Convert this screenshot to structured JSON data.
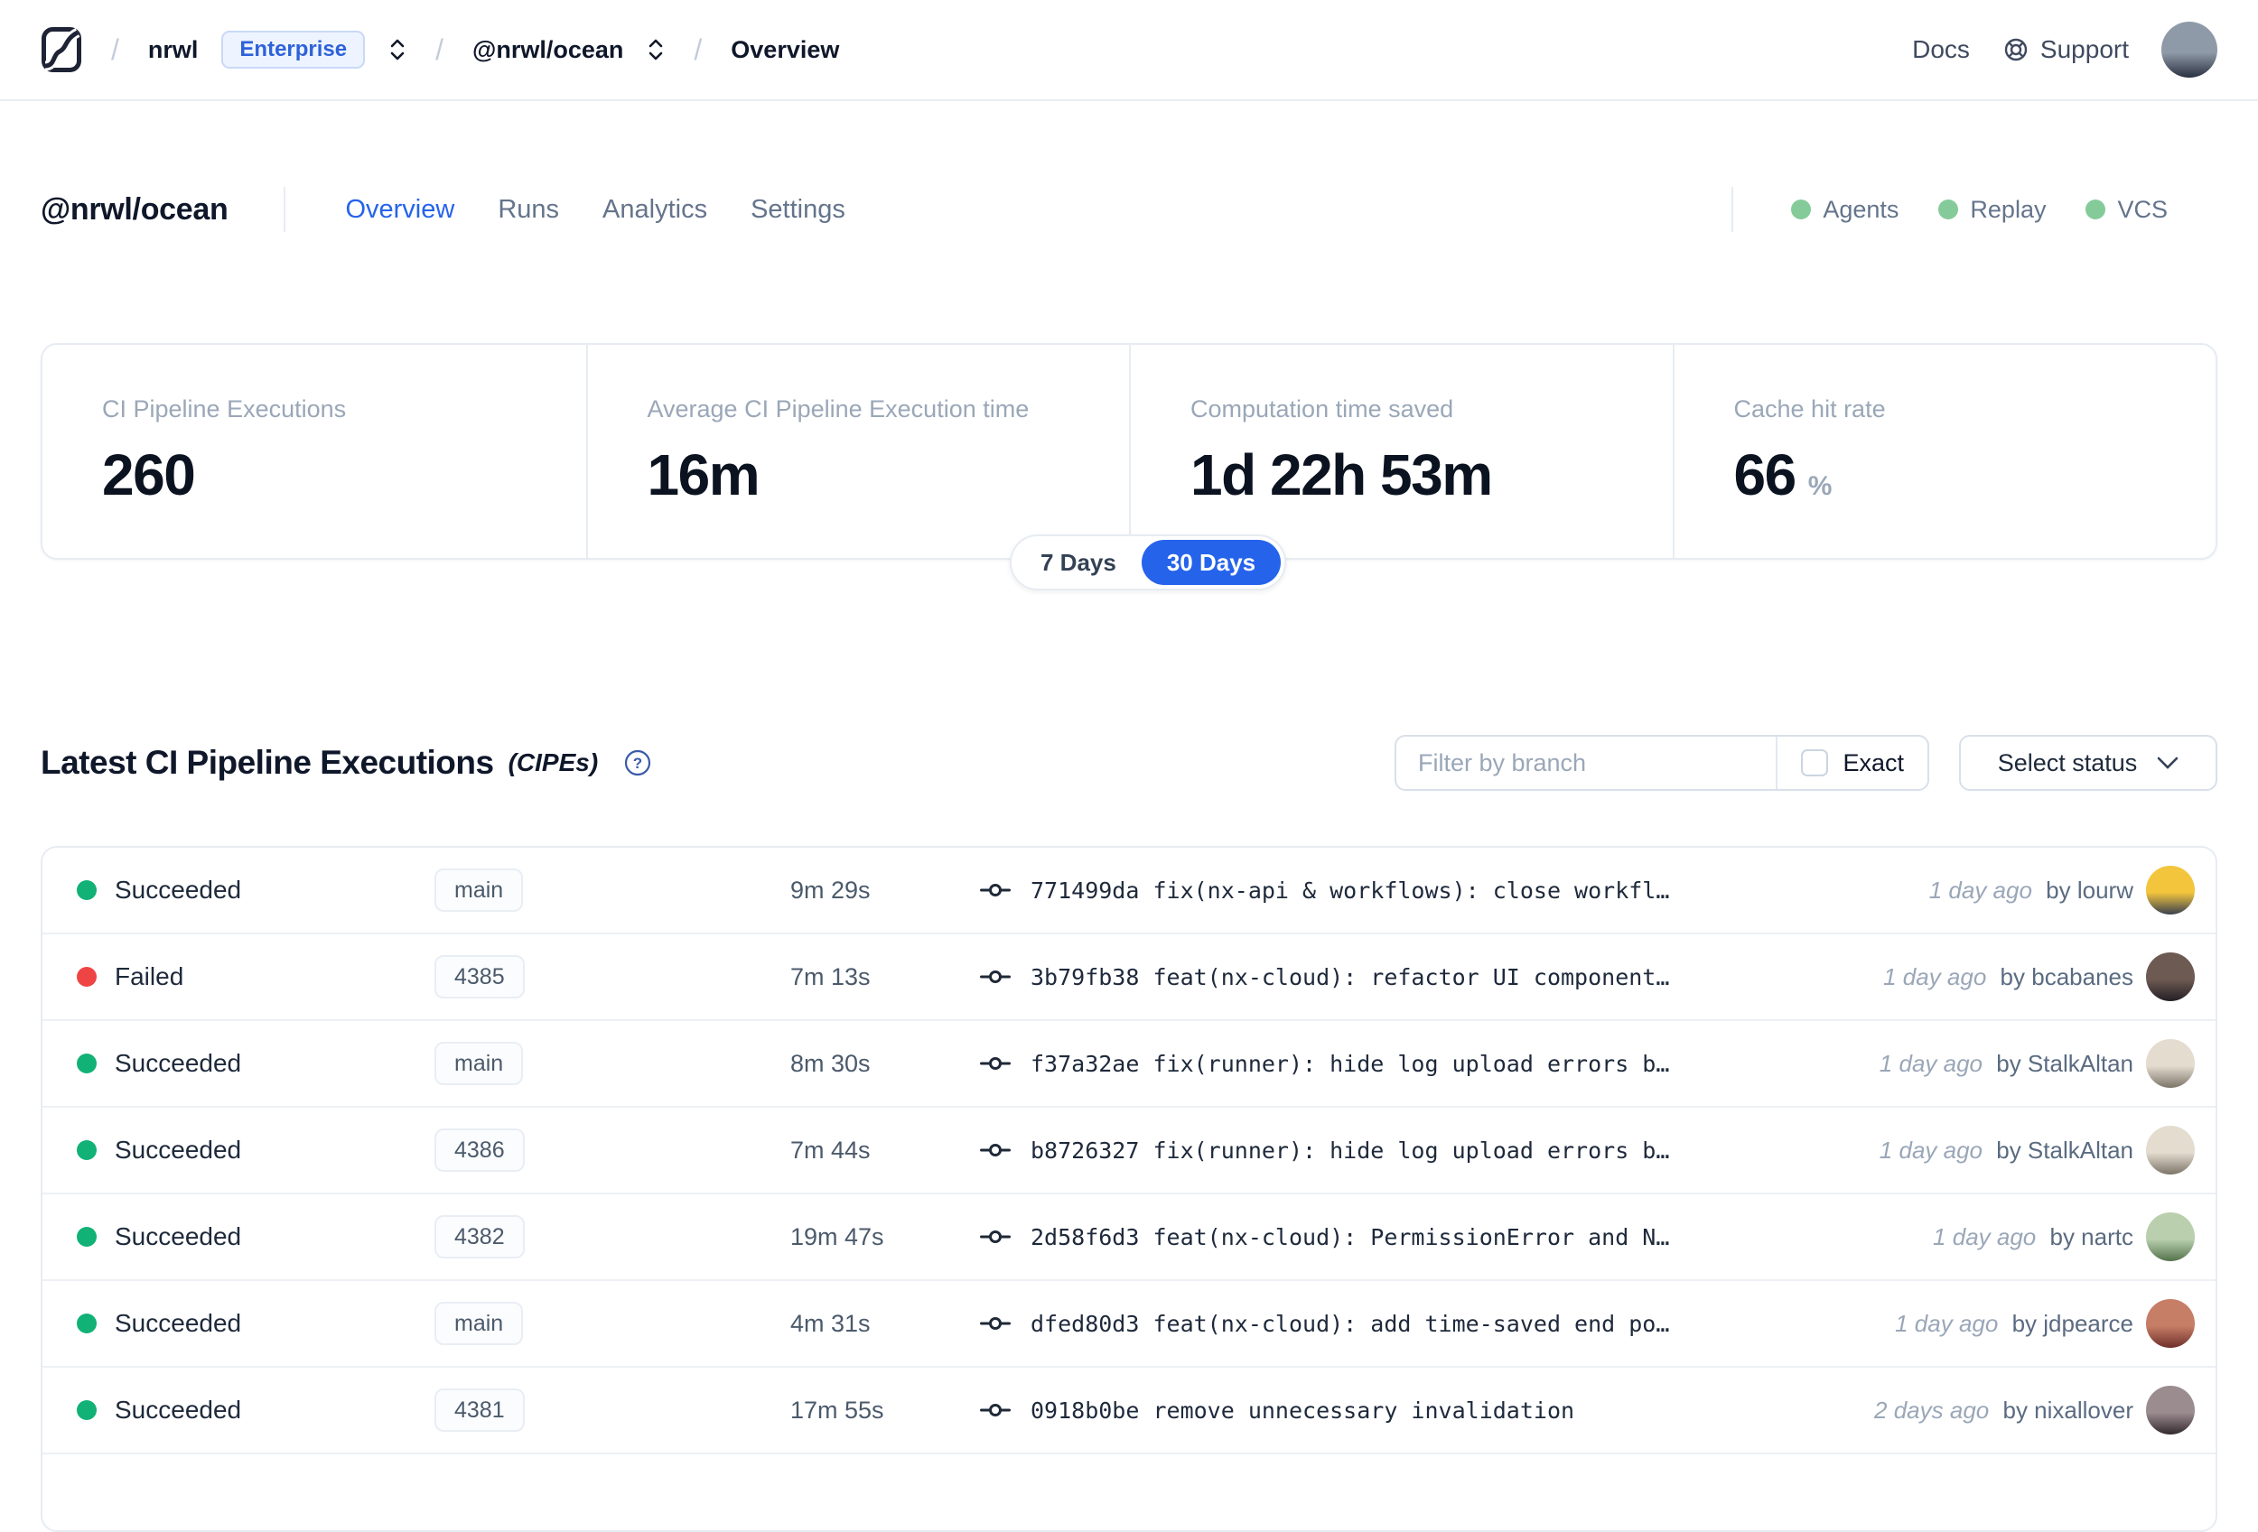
{
  "topbar": {
    "org": "nrwl",
    "org_badge": "Enterprise",
    "workspace": "@nrwl/ocean",
    "page": "Overview",
    "docs_label": "Docs",
    "support_label": "Support",
    "user_avatar_colors": [
      "#8f9aa8",
      "#2a3140"
    ]
  },
  "workspace_header": {
    "title": "@nrwl/ocean",
    "tabs": [
      {
        "label": "Overview",
        "active": true
      },
      {
        "label": "Runs",
        "active": false
      },
      {
        "label": "Analytics",
        "active": false
      },
      {
        "label": "Settings",
        "active": false
      }
    ],
    "indicators": [
      {
        "label": "Agents"
      },
      {
        "label": "Replay"
      },
      {
        "label": "VCS"
      }
    ]
  },
  "stats": {
    "cards": [
      {
        "label": "CI Pipeline Executions",
        "value": "260",
        "suffix": ""
      },
      {
        "label": "Average CI Pipeline Execution time",
        "value": "16m",
        "suffix": ""
      },
      {
        "label": "Computation time saved",
        "value": "1d 22h 53m",
        "suffix": ""
      },
      {
        "label": "Cache hit rate",
        "value": "66",
        "suffix": "%"
      }
    ],
    "range_toggle": {
      "options": [
        "7 Days",
        "30 Days"
      ],
      "selected_index": 1
    }
  },
  "cipe_section": {
    "title": "Latest CI Pipeline Executions",
    "title_suffix": "(CIPEs)",
    "filter_placeholder": "Filter by branch",
    "exact_label": "Exact",
    "status_dropdown_label": "Select status",
    "rows": [
      {
        "status": "Succeeded",
        "branch": "main",
        "duration": "9m 29s",
        "commit": "771499da",
        "message": "fix(nx-api & workflows): close workfl…",
        "time": "1 day ago",
        "author": "by lourw",
        "avatar": [
          "#f2c53d",
          "#39404f"
        ]
      },
      {
        "status": "Failed",
        "branch": "4385",
        "duration": "7m 13s",
        "commit": "3b79fb38",
        "message": "feat(nx-cloud): refactor UI component…",
        "time": "1 day ago",
        "author": "by bcabanes",
        "avatar": [
          "#6d5a52",
          "#241f26"
        ]
      },
      {
        "status": "Succeeded",
        "branch": "main",
        "duration": "8m 30s",
        "commit": "f37a32ae",
        "message": "fix(runner): hide log upload errors b…",
        "time": "1 day ago",
        "author": "by StalkAltan",
        "avatar": [
          "#e3dccf",
          "#7d7468"
        ]
      },
      {
        "status": "Succeeded",
        "branch": "4386",
        "duration": "7m 44s",
        "commit": "b8726327",
        "message": "fix(runner): hide log upload errors b…",
        "time": "1 day ago",
        "author": "by StalkAltan",
        "avatar": [
          "#e3dccf",
          "#7d7468"
        ]
      },
      {
        "status": "Succeeded",
        "branch": "4382",
        "duration": "19m 47s",
        "commit": "2d58f6d3",
        "message": "feat(nx-cloud): PermissionError and N…",
        "time": "1 day ago",
        "author": "by nartc",
        "avatar": [
          "#b9cfae",
          "#53724c"
        ]
      },
      {
        "status": "Succeeded",
        "branch": "main",
        "duration": "4m 31s",
        "commit": "dfed80d3",
        "message": "feat(nx-cloud): add time-saved end po…",
        "time": "1 day ago",
        "author": "by jdpearce",
        "avatar": [
          "#c77e66",
          "#6e2f2a"
        ]
      },
      {
        "status": "Succeeded",
        "branch": "4381",
        "duration": "17m 55s",
        "commit": "0918b0be",
        "message": "remove unnecessary invalidation",
        "time": "2 days ago",
        "author": "by nixallover",
        "avatar": [
          "#9b8c90",
          "#33292e"
        ]
      }
    ]
  },
  "colors": {
    "accent_blue": "#2563eb",
    "succeeded_dot": "#12b176",
    "failed_dot": "#ef4444",
    "indicator_dot": "#84cb99"
  }
}
